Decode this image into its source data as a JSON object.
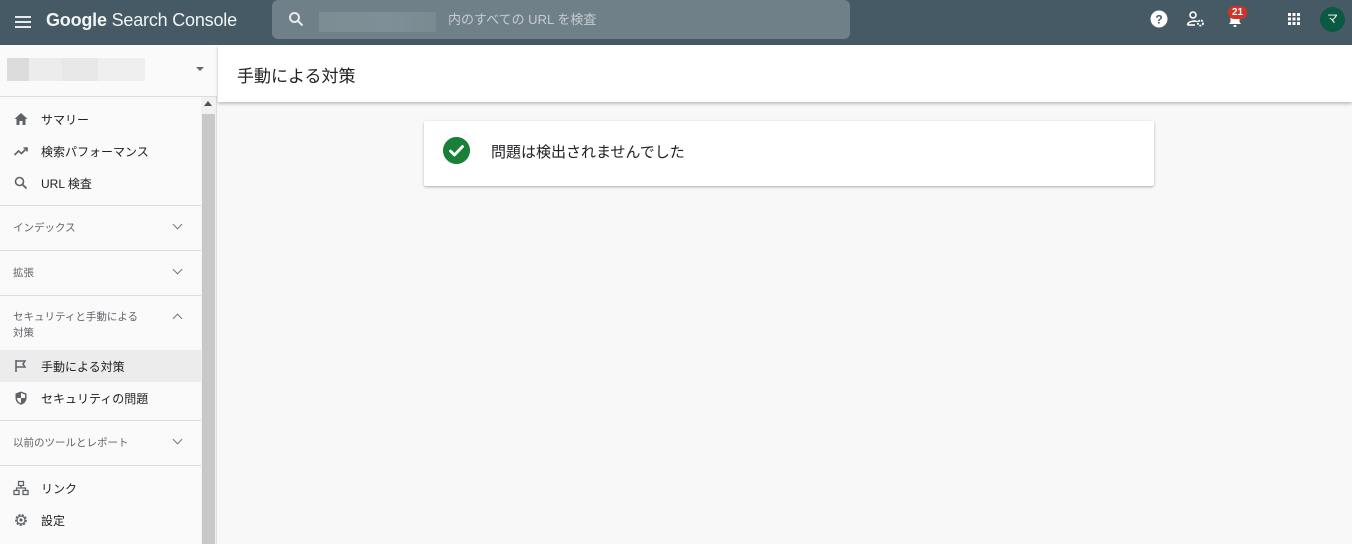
{
  "app": {
    "title_brand": "Google",
    "title_product": "Search Console"
  },
  "search": {
    "placeholder": "内のすべての URL を検査"
  },
  "topbar": {
    "notification_count": "21",
    "avatar_initial": "マ",
    "icons": [
      "menu-icon",
      "search-icon",
      "help-icon",
      "admin-settings-icon",
      "notifications-bell-icon",
      "apps-grid-icon",
      "avatar"
    ]
  },
  "sidebar": {
    "items_top": [
      {
        "label": "サマリー",
        "icon": "home-icon"
      },
      {
        "label": "検索パフォーマンス",
        "icon": "trending-up-icon"
      },
      {
        "label": "URL 検査",
        "icon": "search-icon"
      }
    ],
    "sections": [
      {
        "label": "インデックス",
        "expanded": false
      },
      {
        "label": "拡張",
        "expanded": false
      },
      {
        "label_line1": "セキュリティと手動による",
        "label_line2": "対策",
        "expanded": true
      },
      {
        "label": "以前のツールとレポート",
        "expanded": false
      }
    ],
    "security_items": [
      {
        "label": "手動による対策",
        "icon": "flag-icon",
        "active": true
      },
      {
        "label": "セキュリティの問題",
        "icon": "shield-icon",
        "active": false
      }
    ],
    "items_bottom": [
      {
        "label": "リンク",
        "icon": "sitemap-links-icon"
      },
      {
        "label": "設定",
        "icon": "gear-icon"
      }
    ]
  },
  "main": {
    "page_title": "手動による対策",
    "status_message": "問題は検出されませんでした",
    "status_color": "#188038"
  },
  "colors": {
    "topbar": "#455a64",
    "search_bg": "#6f8088",
    "badge": "#d93025",
    "avatar": "#0b5843"
  }
}
